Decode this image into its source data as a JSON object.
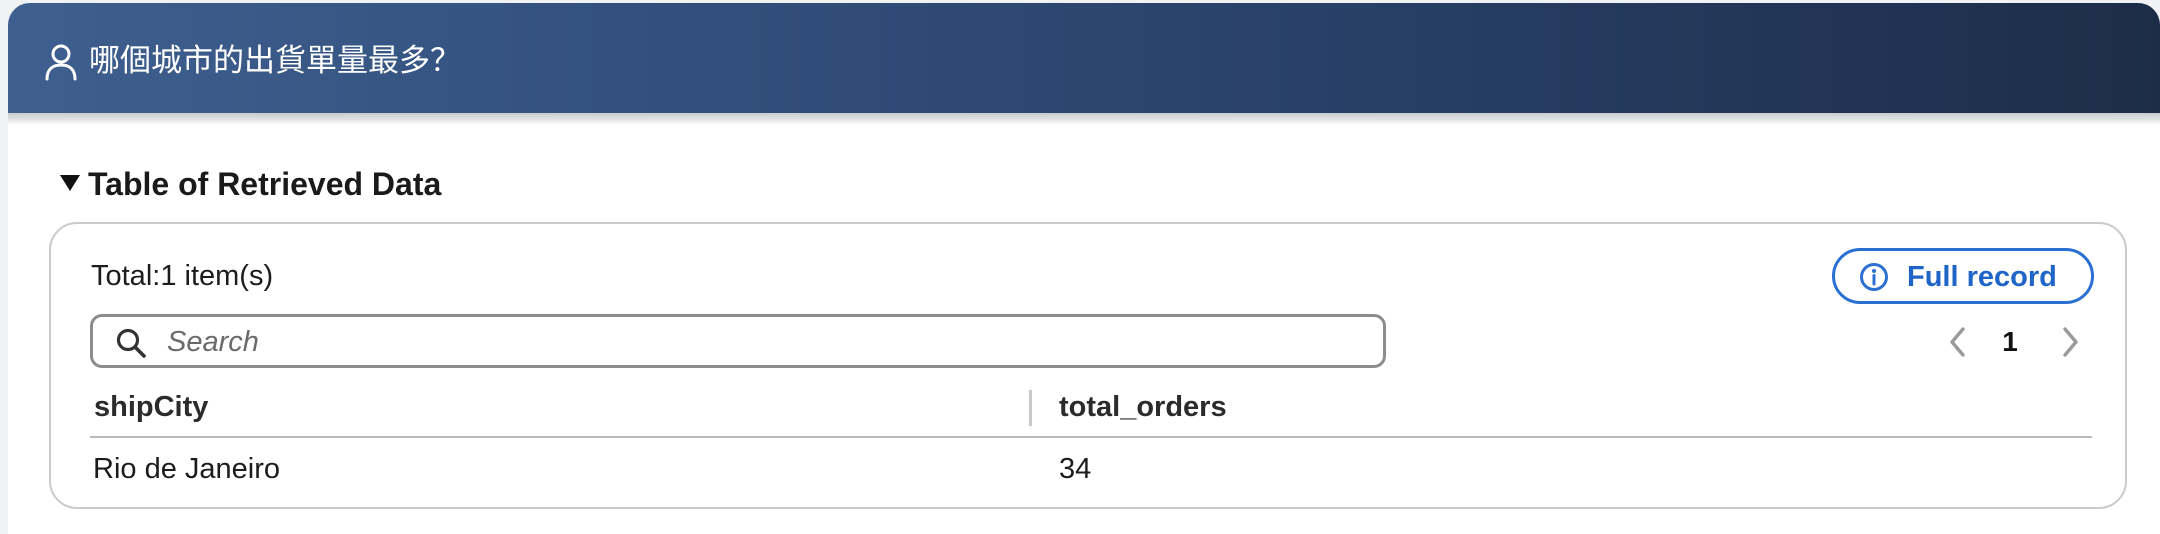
{
  "header": {
    "question": "哪個城市的出貨單量最多？",
    "icon": "user-icon"
  },
  "section": {
    "title": "Table of Retrieved Data",
    "toggle_icon": "caret-down-icon"
  },
  "table_panel": {
    "total_text": "Total:1 item(s)",
    "search": {
      "placeholder": "Search",
      "value": ""
    },
    "full_record_label": "Full record",
    "pagination": {
      "current_page": "1"
    },
    "columns": [
      "shipCity",
      "total_orders"
    ],
    "rows": [
      [
        "Rio de Janeiro",
        "34"
      ]
    ]
  },
  "colors": {
    "header_gradient_start": "#3e5f8f",
    "header_gradient_end": "#1d2d49",
    "accent_blue": "#2a6fd1"
  }
}
